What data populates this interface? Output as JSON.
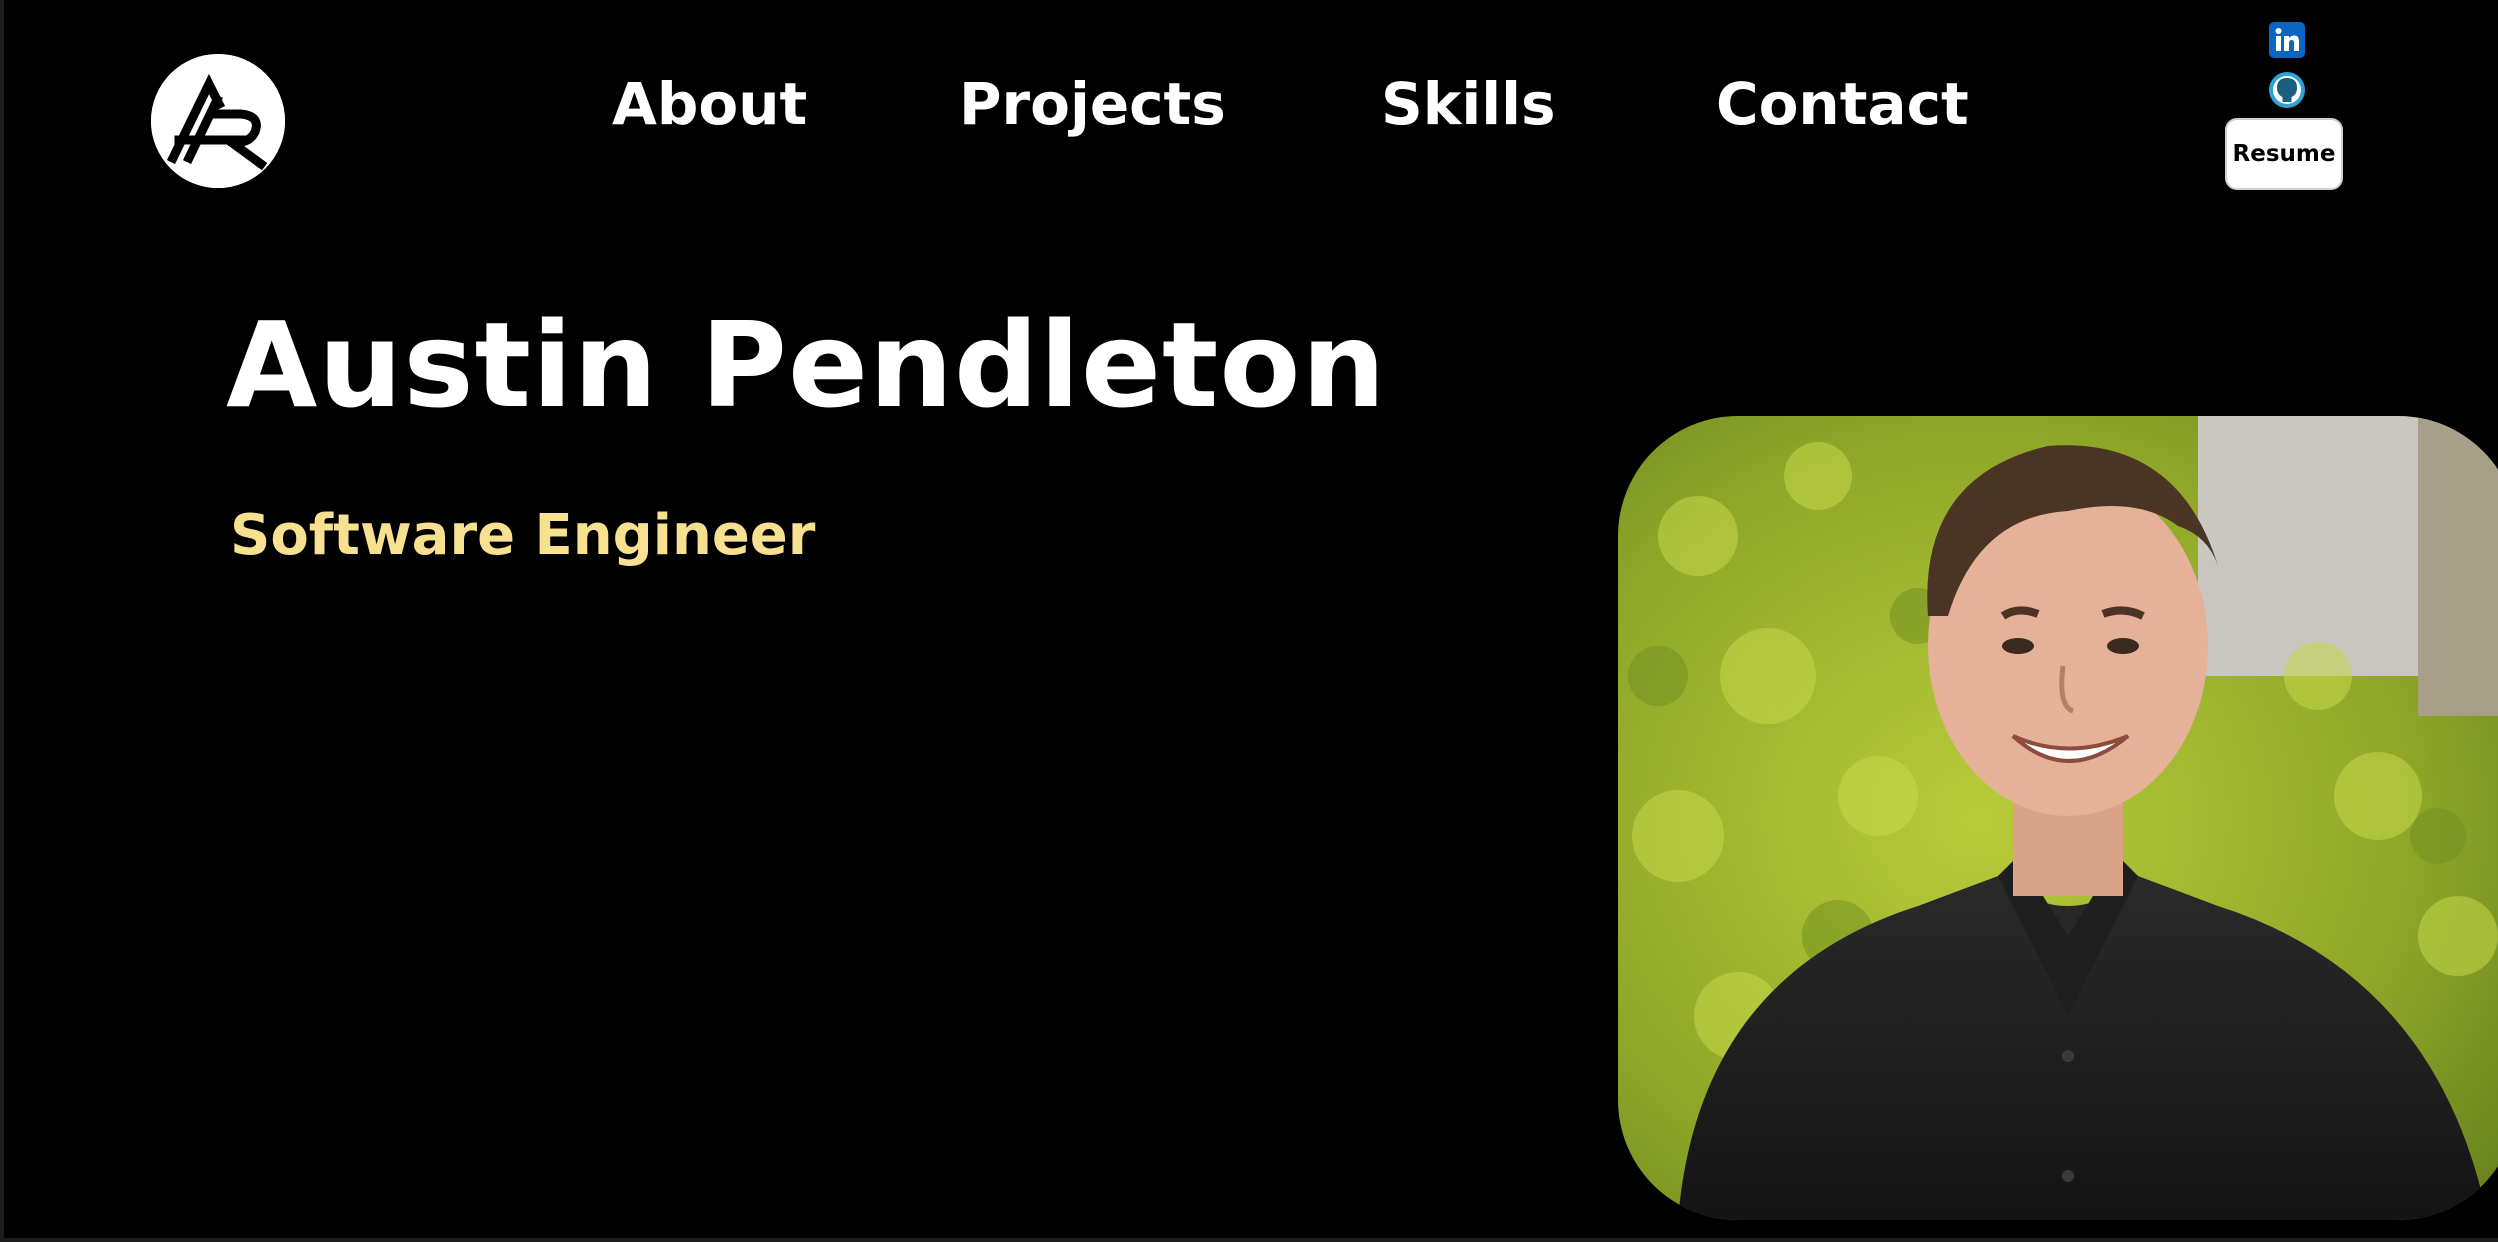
{
  "nav": {
    "items": [
      {
        "label": "About"
      },
      {
        "label": "Projects"
      },
      {
        "label": "Skills"
      },
      {
        "label": "Contact"
      }
    ]
  },
  "header": {
    "logo_icon": "ap-monogram-logo",
    "social": [
      {
        "icon": "linkedin-icon",
        "color": "#0a66c2"
      },
      {
        "icon": "github-icon",
        "color": "#2ea3d6"
      }
    ],
    "resume_label": "Resume"
  },
  "hero": {
    "name": "Austin Pendleton",
    "role": "Software Engineer",
    "role_color": "#f7e08f",
    "photo_icon": "portrait-photo"
  },
  "theme": {
    "background": "#000000",
    "text": "#ffffff"
  }
}
